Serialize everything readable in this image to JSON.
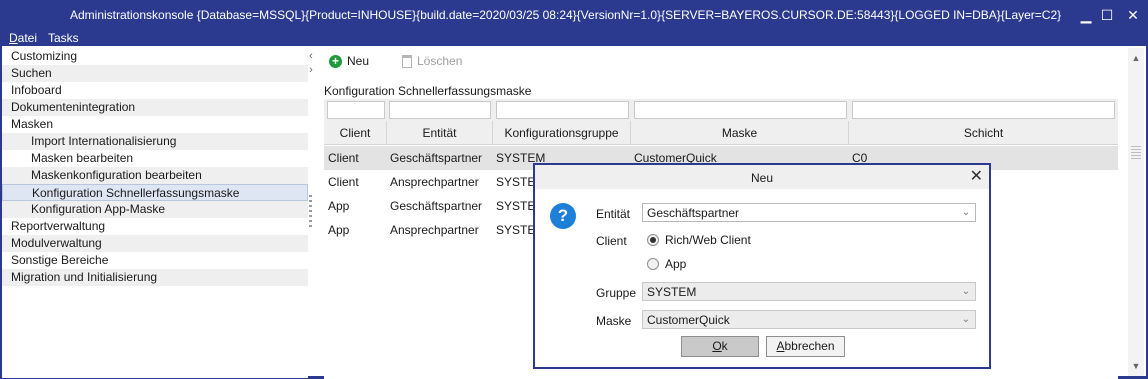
{
  "window": {
    "title": "Administrationskonsole {Database=MSSQL}{Product=INHOUSE}{build.date=2020/03/25 08:24}{VersionNr=1.0}{SERVER=BAYEROS.CURSOR.DE:58443}{LOGGED IN=DBA}{Layer=C2}",
    "minimize": "▁",
    "maximize": "☐",
    "close": "✕"
  },
  "menu": {
    "datei_prefix": "D",
    "datei_rest": "atei",
    "tasks": "Tasks"
  },
  "sidebar": {
    "collapse_left": "‹",
    "collapse_right": "›",
    "items": [
      {
        "label": "Customizing"
      },
      {
        "label": "Suchen"
      },
      {
        "label": "Infoboard"
      },
      {
        "label": "Dokumentenintegration"
      },
      {
        "label": "Masken"
      },
      {
        "label": "Import Internationalisierung"
      },
      {
        "label": "Masken bearbeiten"
      },
      {
        "label": "Maskenkonfiguration bearbeiten"
      },
      {
        "label": "Konfiguration Schnellerfassungsmaske"
      },
      {
        "label": "Konfiguration App-Maske"
      },
      {
        "label": "Reportverwaltung"
      },
      {
        "label": "Modulverwaltung"
      },
      {
        "label": "Sonstige Bereiche"
      },
      {
        "label": "Migration und Initialisierung"
      }
    ]
  },
  "toolbar": {
    "new_label": "Neu",
    "new_icon": "+",
    "delete_label": "Löschen"
  },
  "grid": {
    "title": "Konfiguration Schnellerfassungsmaske",
    "columns": [
      "Client",
      "Entität",
      "Konfigurationsgruppe",
      "Maske",
      "Schicht"
    ],
    "rows": [
      {
        "client": "Client",
        "entity": "Geschäftspartner",
        "group": "SYSTEM",
        "mask": "CustomerQuick",
        "layer": "C0"
      },
      {
        "client": "Client",
        "entity": "Ansprechpartner",
        "group": "SYSTEM",
        "mask": "",
        "layer": ""
      },
      {
        "client": "App",
        "entity": "Geschäftspartner",
        "group": "SYSTEM",
        "mask": "",
        "layer": ""
      },
      {
        "client": "App",
        "entity": "Ansprechpartner",
        "group": "SYSTEM",
        "mask": "",
        "layer": ""
      }
    ]
  },
  "scrollbar": {
    "up": "▲",
    "down": "▼"
  },
  "dialog": {
    "title": "Neu",
    "close": "✕",
    "help_icon": "?",
    "entity_label": "Entität",
    "entity_value": "Geschäftspartner",
    "client_label": "Client",
    "radio_rich": "Rich/Web Client",
    "radio_app": "App",
    "group_label": "Gruppe",
    "group_value": "SYSTEM",
    "mask_label": "Maske",
    "mask_value": "CustomerQuick",
    "chevron": "⌄",
    "ok_prefix": "O",
    "ok_rest": "k",
    "cancel_prefix": "A",
    "cancel_rest": "bbrechen"
  },
  "colors": {
    "titlebar": "#2b3a8f",
    "selected_nav": "#dfe6f3",
    "help": "#1e7fd8",
    "new_icon": "#1f9a3a"
  }
}
